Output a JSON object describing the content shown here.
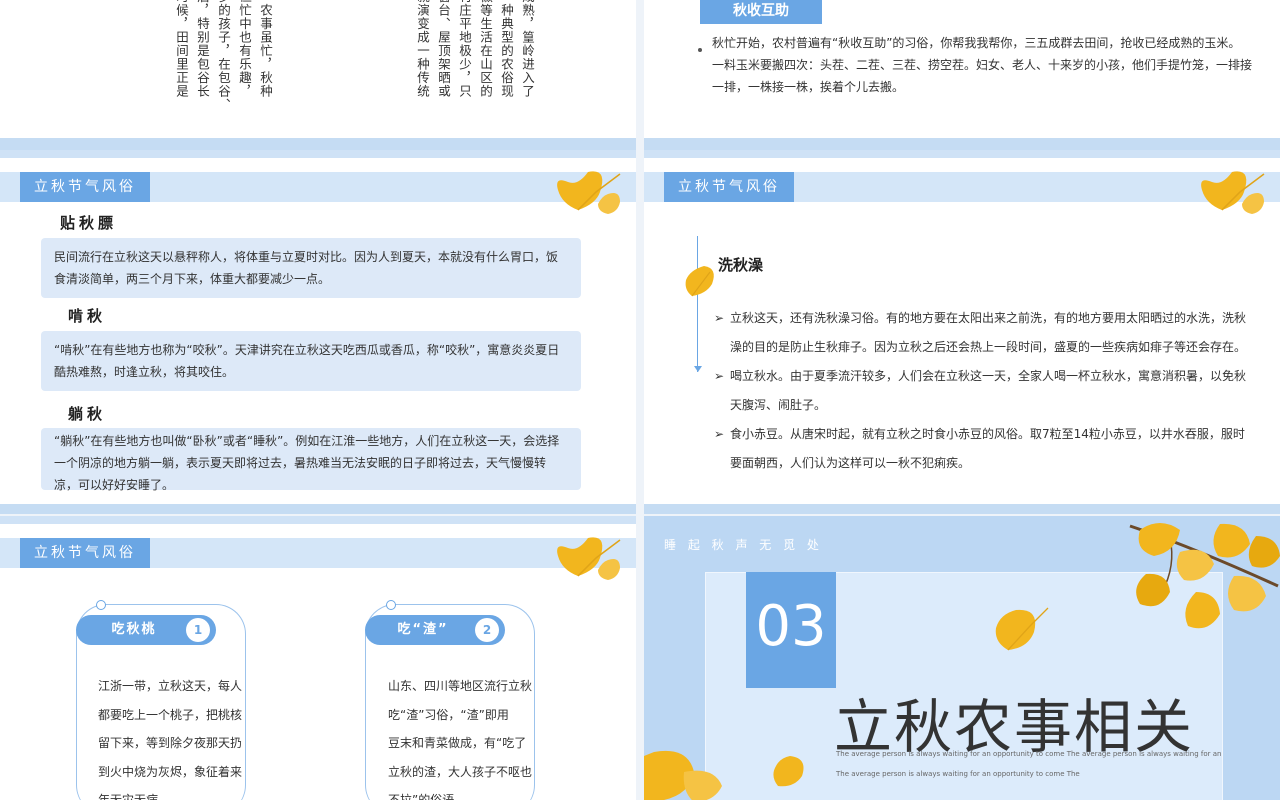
{
  "slide1": {
    "col_left": [
      "。",
      "时候，田间里正是",
      "后，特别是包谷长",
      "岁的孩子，在包谷、",
      "但忙中也有乐趣，",
      "，农事虽忙，秋种"
    ],
    "col_right": [
      "就演变成一种传统",
      "窗台、屋顶架晒或",
      "村庄平地极少，只",
      "徽等生活在山区的",
      "一种典型的农俗现",
      "成熟，篁岭进入了"
    ]
  },
  "slide2": {
    "tag": "秋收互助",
    "text": "秋忙开始，农村普遍有“秋收互助”的习俗，你帮我我帮你，三五成群去田间，抢收已经成熟的玉米。一料玉米要搬四次：头茬、二茬、三茬、捞空茬。妇女、老人、十来岁的小孩，他们手提竹笼，一排接一排，一株接一株，挨着个儿去搬。"
  },
  "slide3": {
    "tag": "立秋节气风俗",
    "items": [
      {
        "title": "贴秋膘",
        "text": "民间流行在立秋这天以悬秤称人，将体重与立夏时对比。因为人到夏天，本就没有什么胃口，饭食清淡简单，两三个月下来，体重大都要减少一点。"
      },
      {
        "title": "啃秋",
        "text": "“啃秋”在有些地方也称为“咬秋”。天津讲究在立秋这天吃西瓜或香瓜，称“咬秋”，寓意炎炎夏日酷热难熬，时逢立秋，将其咬住。"
      },
      {
        "title": "躺秋",
        "text": "“躺秋”在有些地方也叫做“卧秋”或者“睡秋”。例如在江淮一些地方，人们在立秋这一天，会选择一个阴凉的地方躺一躺，表示夏天即将过去，暑热难当无法安眠的日子即将过去，天气慢慢转凉，可以好好安睡了。"
      }
    ]
  },
  "slide4": {
    "tag": "立秋节气风俗",
    "title": "洗秋澡",
    "bullets": [
      "立秋这天，还有洗秋澡习俗。有的地方要在太阳出来之前洗，有的地方要用太阳晒过的水洗，洗秋澡的目的是防止生秋痱子。因为立秋之后还会热上一段时间，盛夏的一些疾病如痱子等还会存在。",
      "喝立秋水。由于夏季流汗较多，人们会在立秋这一天，全家人喝一杯立秋水，寓意消积暑，以免秋天腹泻、闹肚子。",
      "食小赤豆。从唐宋时起，就有立秋之时食小赤豆的风俗。取7粒至14粒小赤豆，以井水吞服，服时要面朝西，人们认为这样可以一秋不犯痢疾。"
    ]
  },
  "slide5": {
    "tag": "立秋节气风俗",
    "cards": [
      {
        "label": "吃秋桃",
        "num": "1",
        "lines": [
          "江浙一带，立秋这天，每人",
          "都要吃上一个桃子，把桃核",
          "留下来，等到除夕夜那天扔",
          "到火中烧为灰烬，象征着来",
          "年无灾无病"
        ]
      },
      {
        "label": "吃“渣”",
        "num": "2",
        "lines": [
          "山东、四川等地区流行立秋",
          "吃“渣”习俗，“渣”即用",
          "豆末和青菜做成，有“吃了",
          "立秋的渣，大人孩子不呕也",
          "不拉”的俗语"
        ]
      }
    ]
  },
  "slide6": {
    "subtitle": "睡 起 秋 声 无 觅 处",
    "number": "03",
    "title": "立秋农事相关",
    "en1": "The average person is always waiting for an opportunity to come The average person is always waiting for an",
    "en2": "The average person is always waiting for an opportunity to come The"
  },
  "colors": {
    "accent": "#6aa6e4",
    "light": "#dde9f8",
    "leaf": "#f2b61e"
  }
}
